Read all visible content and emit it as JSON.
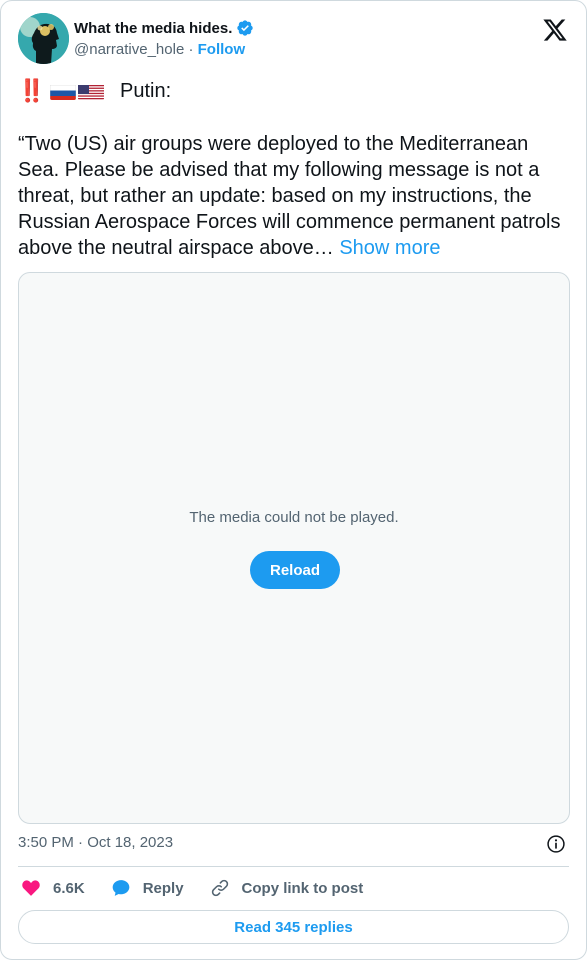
{
  "author": {
    "display_name": "What the media hides.",
    "handle": "@narrative_hole",
    "separator": " · ",
    "follow_label": "Follow",
    "avatar_icon": "avatar-head-icon",
    "verified_icon": "verified-badge-icon"
  },
  "brand_icon": "x-logo-icon",
  "tweet": {
    "bang_emoji": "‼️",
    "flags": [
      "flag-russia-icon",
      "flag-usa-icon"
    ],
    "speaker": "Putin:",
    "body": "“Two (US) air groups were deployed to the Mediterranean Sea. Please be advised that my following message is not a threat, but rather an update: based on my instructions, the Russian Aerospace Forces will commence permanent patrols above the neutral airspace above…",
    "show_more": "Show more"
  },
  "media": {
    "error_message": "The media could not be played.",
    "reload_label": "Reload"
  },
  "meta": {
    "timestamp": "3:50 PM · Oct 18, 2023",
    "info_icon": "info-icon"
  },
  "actions": {
    "likes_count": "6.6K",
    "reply_label": "Reply",
    "copy_link_label": "Copy link to post"
  },
  "read_replies_label": "Read 345 replies",
  "colors": {
    "accent": "#1d9bf0",
    "like": "#f91880",
    "text": "#0f1419",
    "muted": "#536471",
    "border": "#cfd9de",
    "media_bg": "#f7f9f9"
  }
}
